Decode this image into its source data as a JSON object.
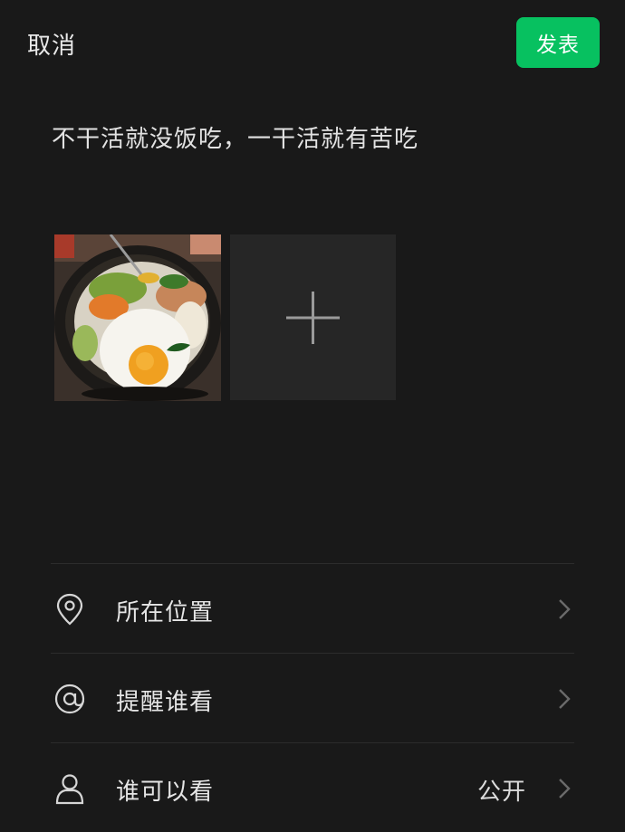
{
  "header": {
    "cancel_label": "取消",
    "publish_label": "发表",
    "publish_color": "#07c160"
  },
  "post": {
    "text": "不干活就没饭吃，一干活就有苦吃"
  },
  "photos": {
    "items": [
      {
        "description_icon": "bibimbap-photo"
      }
    ],
    "add_icon": "plus-icon"
  },
  "options": [
    {
      "icon": "location-pin-icon",
      "label": "所在位置",
      "value": ""
    },
    {
      "icon": "at-sign-icon",
      "label": "提醒谁看",
      "value": ""
    },
    {
      "icon": "person-icon",
      "label": "谁可以看",
      "value": "公开"
    }
  ]
}
